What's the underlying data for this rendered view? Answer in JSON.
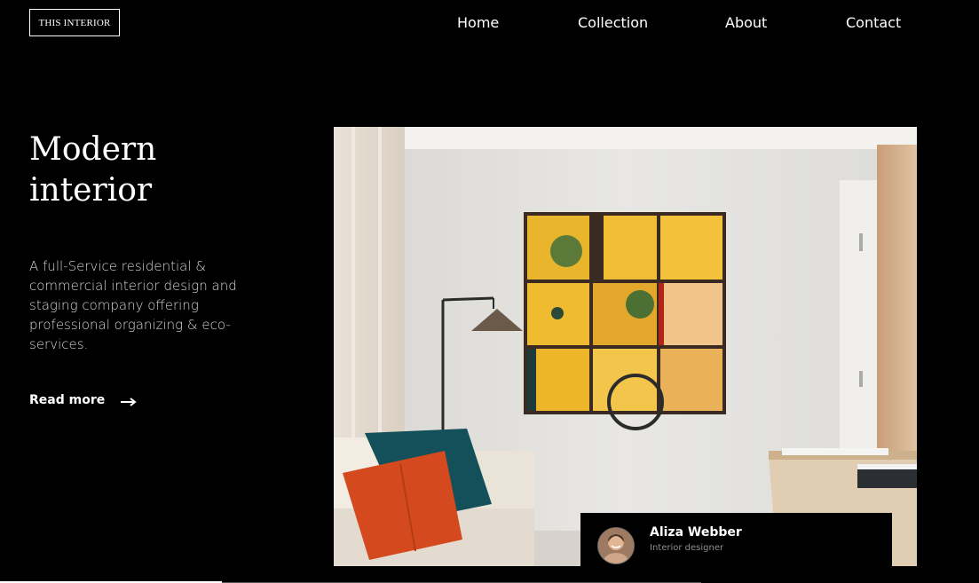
{
  "brand": {
    "logo_text": "THIS INTERIOR"
  },
  "nav": {
    "items": [
      {
        "label": "Home"
      },
      {
        "label": "Collection"
      },
      {
        "label": "About"
      },
      {
        "label": "Contact"
      }
    ]
  },
  "hero": {
    "title_line1": "Modern",
    "title_line2": "interior",
    "description": "A full-Service residential & commercial interior design and staging company offering professional organizing & eco-services.",
    "read_more_label": "Read more"
  },
  "designer": {
    "name": "Aliza Webber",
    "role": "Interior designer"
  },
  "colors": {
    "background": "#000000",
    "text": "#ffffff",
    "muted": "#8e8e8e"
  },
  "icons": {
    "read_more": "arrow-right-icon",
    "photo": "living-room-photo"
  }
}
